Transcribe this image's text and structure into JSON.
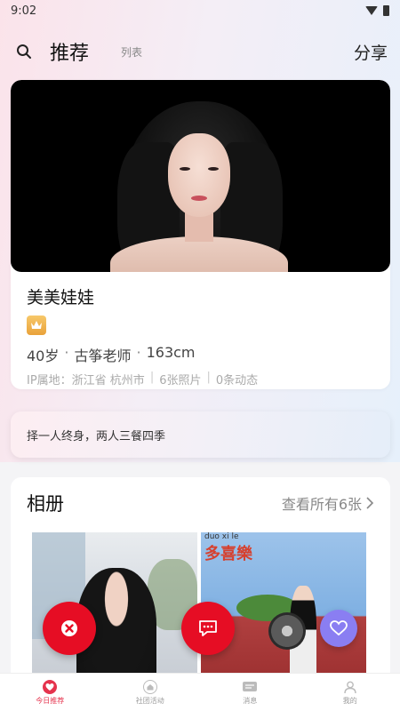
{
  "status_bar": {
    "time": "9:02"
  },
  "header": {
    "tab_active": "推荐",
    "tab_inactive": "列表",
    "share_label": "分享"
  },
  "profile": {
    "name": "美美娃娃",
    "age": "40岁",
    "occupation": "古筝老师",
    "height": "163cm",
    "ip_location": "IP属地：浙江省 杭州市",
    "photo_count": "6张照片",
    "post_count": "0条动态"
  },
  "motto": "择一人终身，两人三餐四季",
  "album": {
    "title": "相册",
    "view_all": "查看所有6张",
    "photo2_caption": "多喜樂",
    "photo2_pinyin": "duo xi le"
  },
  "tab_bar": {
    "items": [
      {
        "label": "今日推荐"
      },
      {
        "label": "社团活动"
      },
      {
        "label": "消息"
      },
      {
        "label": "我的"
      }
    ]
  },
  "colors": {
    "accent_red": "#e60d24",
    "like_purple": "#8a7ef2",
    "active_tab": "#e5334d",
    "vip_gold": "#f0b24a"
  }
}
